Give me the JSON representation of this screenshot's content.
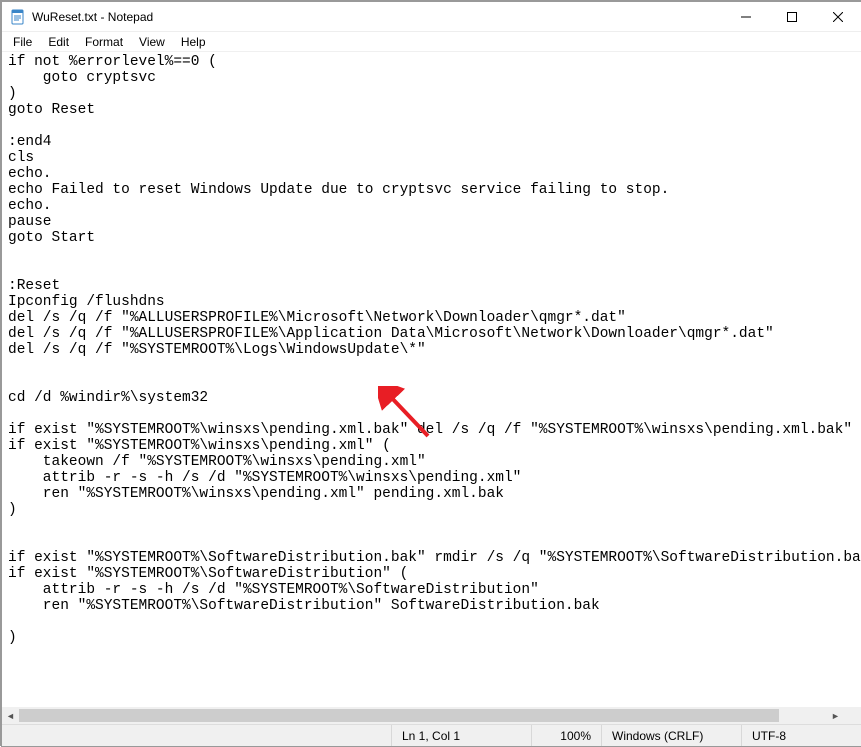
{
  "window": {
    "title": "WuReset.txt - Notepad"
  },
  "menus": {
    "file": "File",
    "edit": "Edit",
    "format": "Format",
    "view": "View",
    "help": "Help"
  },
  "content": "if not %errorlevel%==0 (\n    goto cryptsvc\n)\ngoto Reset\n\n:end4\ncls\necho.\necho Failed to reset Windows Update due to cryptsvc service failing to stop.\necho.\npause\ngoto Start\n\n\n:Reset\nIpconfig /flushdns\ndel /s /q /f \"%ALLUSERSPROFILE%\\Microsoft\\Network\\Downloader\\qmgr*.dat\"\ndel /s /q /f \"%ALLUSERSPROFILE%\\Application Data\\Microsoft\\Network\\Downloader\\qmgr*.dat\"\ndel /s /q /f \"%SYSTEMROOT%\\Logs\\WindowsUpdate\\*\"\n\n\ncd /d %windir%\\system32\n\nif exist \"%SYSTEMROOT%\\winsxs\\pending.xml.bak\" del /s /q /f \"%SYSTEMROOT%\\winsxs\\pending.xml.bak\"\nif exist \"%SYSTEMROOT%\\winsxs\\pending.xml\" (\n    takeown /f \"%SYSTEMROOT%\\winsxs\\pending.xml\"\n    attrib -r -s -h /s /d \"%SYSTEMROOT%\\winsxs\\pending.xml\"\n    ren \"%SYSTEMROOT%\\winsxs\\pending.xml\" pending.xml.bak\n)\n\n\nif exist \"%SYSTEMROOT%\\SoftwareDistribution.bak\" rmdir /s /q \"%SYSTEMROOT%\\SoftwareDistribution.bak\"\nif exist \"%SYSTEMROOT%\\SoftwareDistribution\" (\n    attrib -r -s -h /s /d \"%SYSTEMROOT%\\SoftwareDistribution\"\n    ren \"%SYSTEMROOT%\\SoftwareDistribution\" SoftwareDistribution.bak\n\n)\n",
  "status": {
    "position": "Ln 1, Col 1",
    "zoom": "100%",
    "line_ending": "Windows (CRLF)",
    "encoding": "UTF-8"
  },
  "annotation": {
    "arrow_color": "#E81E25"
  }
}
